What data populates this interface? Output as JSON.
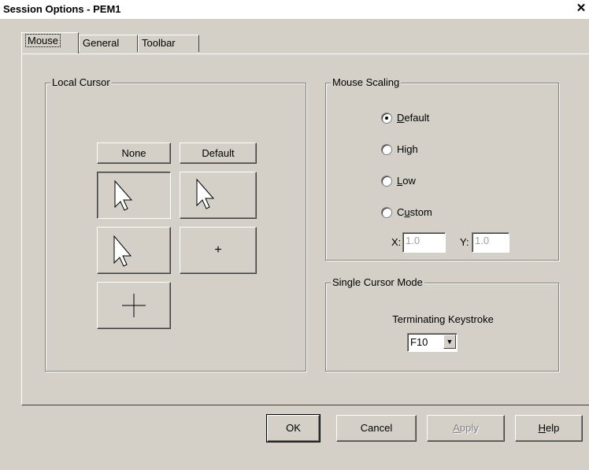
{
  "window": {
    "title": "Session Options - PEM1",
    "close_symbol": "✕"
  },
  "tabs": [
    {
      "label": "Mouse",
      "active": true
    },
    {
      "label": "General",
      "active": false
    },
    {
      "label": "Toolbar",
      "active": false
    }
  ],
  "local_cursor": {
    "label": "Local Cursor",
    "none_button": "None",
    "default_button": "Default",
    "options": [
      "arrow-large",
      "arrow-outline",
      "arrow-small",
      "plus-small",
      "crosshair"
    ],
    "small_plus_symbol": "+"
  },
  "mouse_scaling": {
    "label": "Mouse Scaling",
    "options": [
      {
        "prefix": "",
        "mnemonic": "D",
        "suffix": "efault",
        "checked": true
      },
      {
        "prefix": "Hi",
        "mnemonic": "g",
        "suffix": "h",
        "checked": false
      },
      {
        "prefix": "",
        "mnemonic": "L",
        "suffix": "ow",
        "checked": false
      },
      {
        "prefix": "C",
        "mnemonic": "u",
        "suffix": "stom",
        "checked": false
      }
    ],
    "x_label": "X:",
    "x_value": "1.0",
    "y_label": "Y:",
    "y_value": "1.0"
  },
  "single_cursor": {
    "label": "Single Cursor Mode",
    "keystroke_label": "Terminating Keystroke",
    "keystroke_value": "F10",
    "dropdown_icon": "▼"
  },
  "buttons": {
    "ok": "OK",
    "cancel": "Cancel",
    "apply_mnemonic": "A",
    "apply_rest": "pply",
    "help_mnemonic": "H",
    "help_rest": "elp"
  }
}
